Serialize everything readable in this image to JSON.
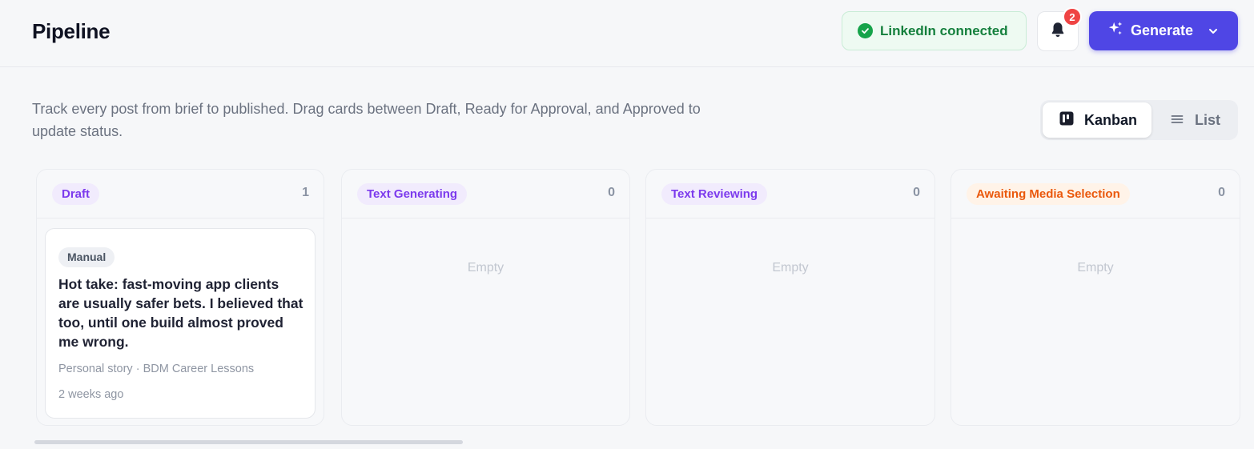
{
  "header": {
    "title": "Pipeline",
    "linkedin_status": "LinkedIn connected",
    "notification_count": "2",
    "generate_label": "Generate"
  },
  "intro": {
    "description": "Track every post from brief to published. Drag cards between Draft, Ready for Approval, and Approved to update status."
  },
  "view_toggle": {
    "kanban_label": "Kanban",
    "list_label": "List",
    "selected": "Kanban"
  },
  "columns": [
    {
      "label": "Draft",
      "count": "1",
      "label_color": "#7c3aed",
      "label_bg": "#f1ebfd"
    },
    {
      "label": "Text Generating",
      "count": "0",
      "empty_text": "Empty",
      "label_color": "#7c3aed",
      "label_bg": "#f1ebfd"
    },
    {
      "label": "Text Reviewing",
      "count": "0",
      "empty_text": "Empty",
      "label_color": "#7c3aed",
      "label_bg": "#f1ebfd"
    },
    {
      "label": "Awaiting Media Selection",
      "count": "0",
      "empty_text": "Empty",
      "label_color": "#ea580c",
      "label_bg": "#fff3e8"
    }
  ],
  "draft_card": {
    "source_badge": "Manual",
    "title": "Hot take: fast-moving app clients are usually safer bets. I believed that too, until one build almost proved me wrong.",
    "meta": "Personal story · BDM Career Lessons",
    "time": "2 weeks ago"
  },
  "icons": {
    "linkedin_status": "check-circle-icon",
    "notifications": "bell-icon",
    "generate": "sparkles-icon",
    "generate_menu": "chevron-down-icon",
    "kanban": "kanban-icon",
    "list": "list-icon"
  },
  "colors": {
    "accent": "#4f46e5",
    "success": "#16a34a",
    "badge": "#ef4444"
  }
}
